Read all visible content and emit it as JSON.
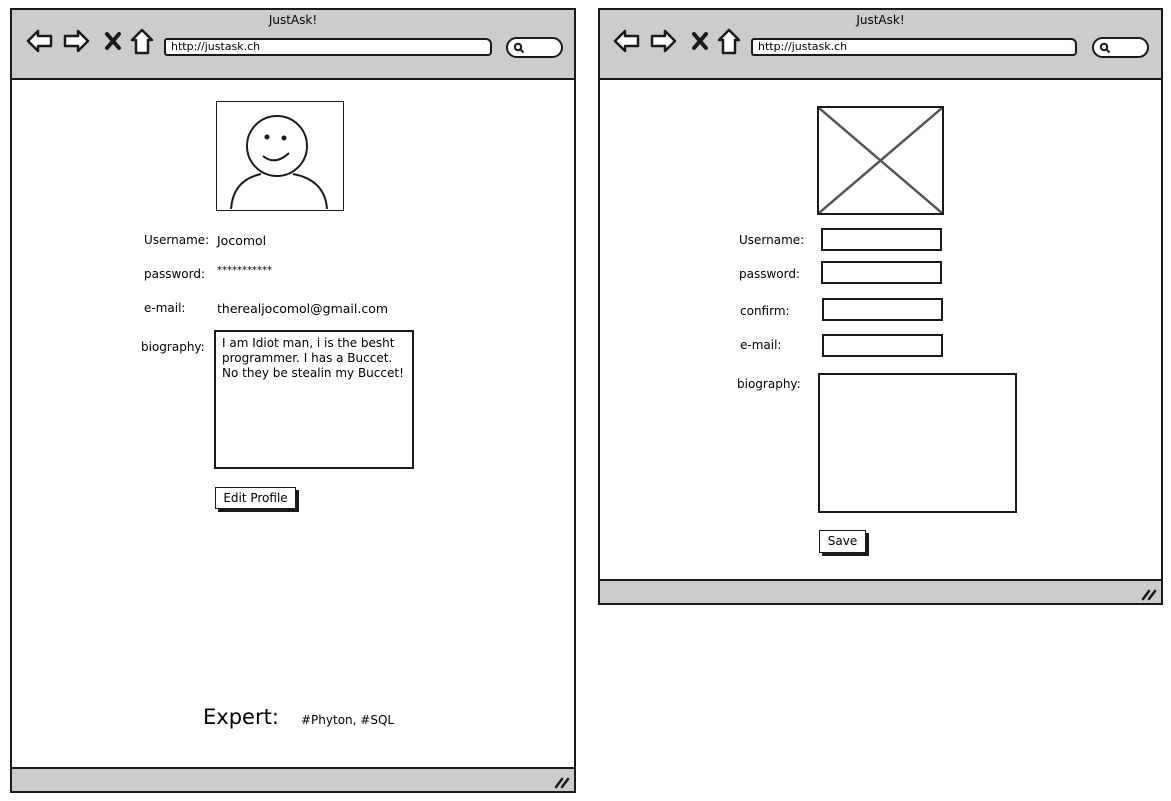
{
  "windows": [
    {
      "title": "JustAsk!",
      "url": "http://justask.ch",
      "profile": {
        "username_label": "Username:",
        "username_value": "Jocomol",
        "password_label": "password:",
        "password_value": "***********",
        "email_label": "e-mail:",
        "email_value": "therealjocomol@gmail.com",
        "biography_label": "biography:",
        "biography_value": "I am Idiot man, i is the besht programmer. I has a Buccet. No they be stealin my Buccet!",
        "edit_button": "Edit Profile",
        "expert_label": "Expert:",
        "expert_tags": "#Phyton, #SQL"
      }
    },
    {
      "title": "JustAsk!",
      "url": "http://justask.ch",
      "form": {
        "username_label": "Username:",
        "password_label": "password:",
        "confirm_label": "confirm:",
        "email_label": "e-mail:",
        "biography_label": "biography:",
        "save_button": "Save"
      }
    }
  ],
  "icons": [
    "back-arrow-icon",
    "forward-arrow-icon",
    "close-icon",
    "home-icon",
    "search-icon",
    "resize-grip-icon",
    "avatar-smiley-icon",
    "image-placeholder-icon"
  ],
  "colors": {
    "chrome": "#cccccc",
    "border": "#1a1a1a",
    "background": "#ffffff"
  }
}
